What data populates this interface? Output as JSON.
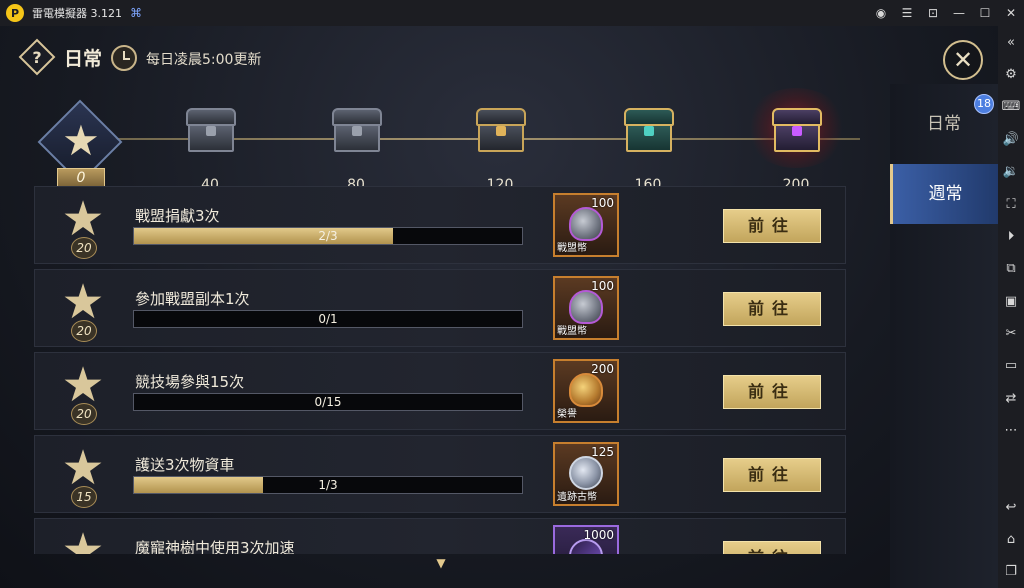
{
  "emulator": {
    "logo_glyph": "P",
    "title": "雷電模擬器 3.121",
    "gamepad_glyph": "⌘",
    "window_controls": [
      "◉",
      "☰",
      "⊡",
      "—",
      "☐",
      "✕"
    ],
    "sidebar_icons": [
      {
        "name": "collapse-icon",
        "glyph": "«"
      },
      {
        "name": "settings-icon",
        "glyph": "⚙"
      },
      {
        "name": "keyboard-icon",
        "glyph": "⌨"
      },
      {
        "name": "volume-up-icon",
        "glyph": "🔊"
      },
      {
        "name": "volume-down-icon",
        "glyph": "🔉"
      },
      {
        "name": "fullscreen-icon",
        "glyph": "⛶"
      },
      {
        "name": "record-icon",
        "glyph": "⏵"
      },
      {
        "name": "multi-instance-icon",
        "glyph": "⧉"
      },
      {
        "name": "screenshot-icon",
        "glyph": "▣"
      },
      {
        "name": "scissors-icon",
        "glyph": "✂"
      },
      {
        "name": "video-icon",
        "glyph": "▭"
      },
      {
        "name": "sync-icon",
        "glyph": "⇄"
      },
      {
        "name": "more-icon",
        "glyph": "⋯"
      },
      {
        "name": "back-icon",
        "glyph": "↩"
      },
      {
        "name": "home-icon",
        "glyph": "⌂"
      },
      {
        "name": "recent-apps-icon",
        "glyph": "❐"
      }
    ]
  },
  "header": {
    "help_glyph": "?",
    "title": "日常",
    "refresh_note": "每日凌晨5:00更新",
    "close_glyph": "✕"
  },
  "track": {
    "current_points": "0",
    "milestones": [
      {
        "label": "40",
        "chest": "plain"
      },
      {
        "label": "80",
        "chest": "plain"
      },
      {
        "label": "120",
        "chest": "gold"
      },
      {
        "label": "160",
        "chest": "jade"
      },
      {
        "label": "200",
        "chest": "royal"
      }
    ]
  },
  "quests": [
    {
      "title": "戰盟捐獻3次",
      "points": "20",
      "progress_text": "2/3",
      "progress": 0.667,
      "reward_qty": "100",
      "reward_name": "戰盟幣",
      "reward_icon": "shield",
      "button": "前往"
    },
    {
      "title": "參加戰盟副本1次",
      "points": "20",
      "progress_text": "0/1",
      "progress": 0,
      "reward_qty": "100",
      "reward_name": "戰盟幣",
      "reward_icon": "shield",
      "button": "前往"
    },
    {
      "title": "競技場參與15次",
      "points": "20",
      "progress_text": "0/15",
      "progress": 0,
      "reward_qty": "200",
      "reward_name": "榮譽",
      "reward_icon": "medal",
      "button": "前往"
    },
    {
      "title": "護送3次物資車",
      "points": "15",
      "progress_text": "1/3",
      "progress": 0.333,
      "reward_qty": "125",
      "reward_name": "遺跡古幣",
      "reward_icon": "coin",
      "button": "前往"
    },
    {
      "title": "魔寵神樹中使用3次加速",
      "points": "",
      "progress_text": "",
      "progress": 0,
      "reward_qty": "1000",
      "reward_name": "",
      "reward_icon": "shard",
      "button": "前往"
    }
  ],
  "scroll_glyph": "▼",
  "tabs": {
    "daily": "日常",
    "daily_badge": "18",
    "weekly": "週常"
  },
  "star_glyph": "★"
}
